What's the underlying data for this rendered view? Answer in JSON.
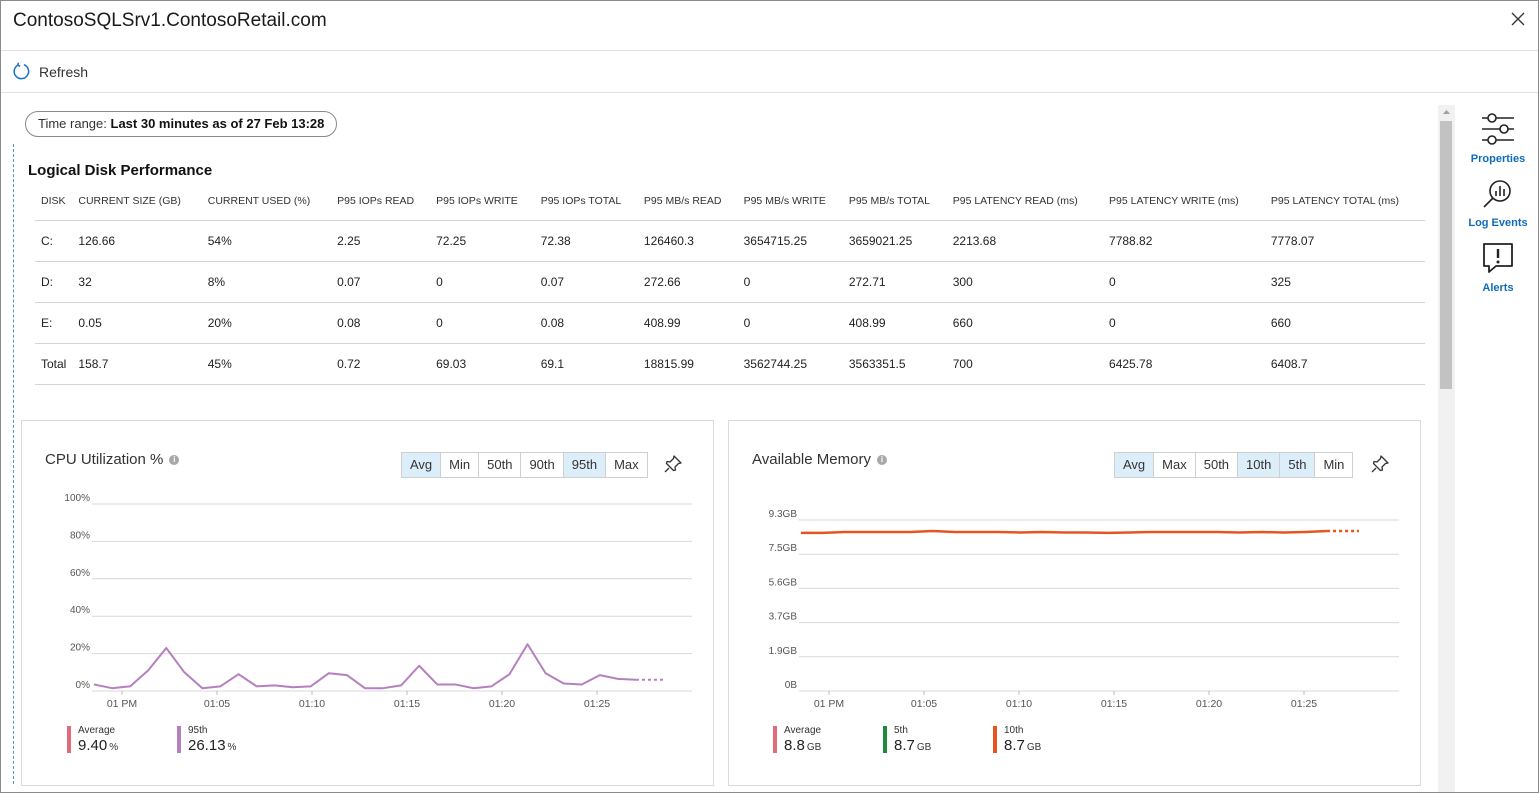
{
  "window": {
    "title": "ContosoSQLSrv1.ContosoRetail.com"
  },
  "toolbar": {
    "refresh_label": "Refresh"
  },
  "time_range": {
    "label": "Time range:",
    "value": "Last 30 minutes as of 27 Feb 13:28"
  },
  "disk_section": {
    "title": "Logical Disk Performance",
    "columns": [
      "DISK",
      "CURRENT SIZE (GB)",
      "CURRENT USED (%)",
      "P95 IOPs READ",
      "P95 IOPs WRITE",
      "P95 IOPs TOTAL",
      "P95 MB/s READ",
      "P95 MB/s WRITE",
      "P95 MB/s TOTAL",
      "P95 LATENCY READ (ms)",
      "P95 LATENCY WRITE (ms)",
      "P95 LATENCY TOTAL (ms)"
    ],
    "rows": [
      [
        "C:",
        "126.66",
        "54%",
        "2.25",
        "72.25",
        "72.38",
        "126460.3",
        "3654715.25",
        "3659021.25",
        "2213.68",
        "7788.82",
        "7778.07"
      ],
      [
        "D:",
        "32",
        "8%",
        "0.07",
        "0",
        "0.07",
        "272.66",
        "0",
        "272.71",
        "300",
        "0",
        "325"
      ],
      [
        "E:",
        "0.05",
        "20%",
        "0.08",
        "0",
        "0.08",
        "408.99",
        "0",
        "408.99",
        "660",
        "0",
        "660"
      ],
      [
        "Total",
        "158.7",
        "45%",
        "0.72",
        "69.03",
        "69.1",
        "18815.99",
        "3562744.25",
        "3563351.5",
        "700",
        "6425.78",
        "6408.7"
      ]
    ]
  },
  "cpu_card": {
    "title": "CPU Utilization %",
    "toggles": [
      {
        "label": "Avg",
        "active": true
      },
      {
        "label": "Min",
        "active": false
      },
      {
        "label": "50th",
        "active": false
      },
      {
        "label": "90th",
        "active": false
      },
      {
        "label": "95th",
        "active": true
      },
      {
        "label": "Max",
        "active": false
      }
    ],
    "legend": [
      {
        "name": "Average",
        "value": "9.40",
        "unit": "%",
        "color": "#e06c7a"
      },
      {
        "name": "95th",
        "value": "26.13",
        "unit": "%",
        "color": "#b57fc0"
      }
    ]
  },
  "memory_card": {
    "title": "Available Memory",
    "toggles": [
      {
        "label": "Avg",
        "active": true
      },
      {
        "label": "Max",
        "active": false
      },
      {
        "label": "50th",
        "active": false
      },
      {
        "label": "10th",
        "active": true
      },
      {
        "label": "5th",
        "active": true
      },
      {
        "label": "Min",
        "active": false
      }
    ],
    "legend": [
      {
        "name": "Average",
        "value": "8.8",
        "unit": "GB",
        "color": "#e06c7a"
      },
      {
        "name": "5th",
        "value": "8.7",
        "unit": "GB",
        "color": "#1e8a3e"
      },
      {
        "name": "10th",
        "value": "8.7",
        "unit": "GB",
        "color": "#e8541e"
      }
    ]
  },
  "sidebar": {
    "items": [
      {
        "label": "Properties",
        "icon": "sliders-icon"
      },
      {
        "label": "Log Events",
        "icon": "log-search-icon"
      },
      {
        "label": "Alerts",
        "icon": "alert-icon"
      }
    ]
  },
  "chart_data": [
    {
      "type": "line",
      "title": "CPU Utilization %",
      "x_ticks": [
        "01 PM",
        "01:05",
        "01:10",
        "01:15",
        "01:20",
        "01:25"
      ],
      "y_ticks": [
        "100%",
        "80%",
        "60%",
        "40%",
        "20%",
        "0%"
      ],
      "ylim": [
        0,
        100
      ],
      "series": [
        {
          "name": "95th",
          "color": "#b57fc0",
          "values": [
            3.5,
            1.5,
            2.5,
            11,
            23,
            10,
            1.5,
            2.5,
            9,
            2.5,
            3,
            2,
            2.5,
            9.5,
            8.5,
            1.5,
            1.5,
            3,
            13.5,
            3.5,
            3.5,
            1.5,
            2.5,
            9,
            25,
            9.5,
            4,
            3.5,
            8.5,
            6.5,
            6,
            6
          ]
        }
      ]
    },
    {
      "type": "line",
      "title": "Available Memory",
      "x_ticks": [
        "01 PM",
        "01:05",
        "01:10",
        "01:15",
        "01:20",
        "01:25"
      ],
      "y_ticks": [
        "9.3GB",
        "7.5GB",
        "5.6GB",
        "3.7GB",
        "1.9GB",
        "0B"
      ],
      "ylim": [
        0,
        9.3
      ],
      "series": [
        {
          "name": "10th",
          "color": "#e8541e",
          "values": [
            8.6,
            8.6,
            8.65,
            8.65,
            8.65,
            8.65,
            8.7,
            8.65,
            8.65,
            8.65,
            8.62,
            8.65,
            8.62,
            8.62,
            8.6,
            8.62,
            8.65,
            8.65,
            8.65,
            8.65,
            8.62,
            8.65,
            8.62,
            8.65,
            8.7,
            8.7
          ]
        }
      ]
    }
  ]
}
